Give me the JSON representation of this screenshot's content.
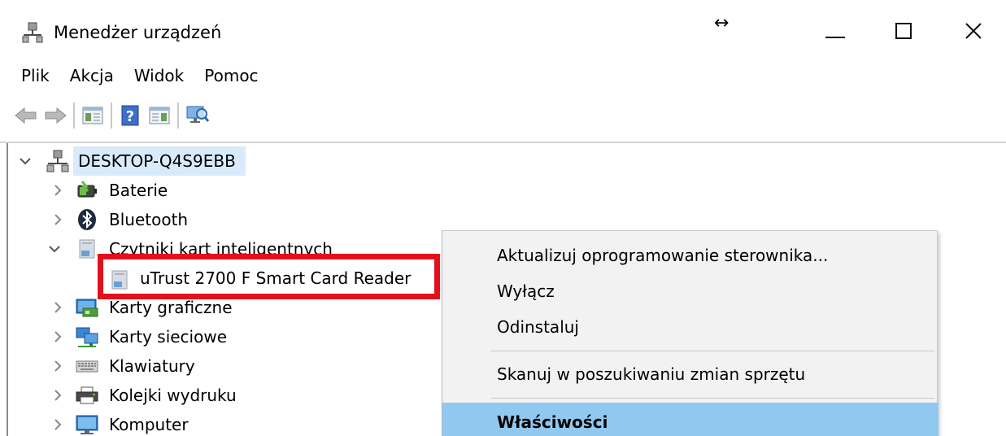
{
  "window": {
    "title": "Menedżer urządzeń",
    "icons": {
      "app": "device-manager-icon",
      "cursor": "resize-horizontal-cursor"
    }
  },
  "menu": {
    "items": [
      "Plik",
      "Akcja",
      "Widok",
      "Pomoc"
    ]
  },
  "toolbar": {
    "buttons": [
      "back-arrow-icon",
      "forward-arrow-icon",
      "show-hide-console-tree-icon",
      "help-icon",
      "action-pane-icon",
      "scan-hardware-icon"
    ]
  },
  "tree": {
    "root": {
      "label": "DESKTOP-Q4S9EBB",
      "icon": "computer-network-icon",
      "expanded": true,
      "selected": true
    },
    "items": [
      {
        "label": "Baterie",
        "icon": "battery-icon",
        "expanded": false
      },
      {
        "label": "Bluetooth",
        "icon": "bluetooth-icon",
        "expanded": false
      },
      {
        "label": "Czytniki kart inteligentnych",
        "icon": "smart-card-reader-icon",
        "expanded": true
      },
      {
        "label": "uTrust 2700 F Smart Card Reader",
        "icon": "smart-card-reader-icon",
        "child": true
      },
      {
        "label": "Karty graficzne",
        "icon": "display-adapter-icon",
        "expanded": false
      },
      {
        "label": "Karty sieciowe",
        "icon": "network-adapter-icon",
        "expanded": false
      },
      {
        "label": "Klawiatury",
        "icon": "keyboard-icon",
        "expanded": false
      },
      {
        "label": "Kolejki wydruku",
        "icon": "printer-icon",
        "expanded": false
      },
      {
        "label": "Komputer",
        "icon": "monitor-icon",
        "expanded": false
      }
    ]
  },
  "context_menu": {
    "items": [
      {
        "label": "Aktualizuj oprogramowanie sterownika..."
      },
      {
        "label": "Wyłącz"
      },
      {
        "label": "Odinstaluj"
      },
      {
        "label": "Skanuj w poszukiwaniu zmian sprzętu"
      },
      {
        "label": "Właściwości",
        "highlighted": true
      }
    ]
  },
  "colors": {
    "highlight_box": "#e3101c",
    "menu_hover": "#91c8f0",
    "selection": "#d9ebfa"
  }
}
